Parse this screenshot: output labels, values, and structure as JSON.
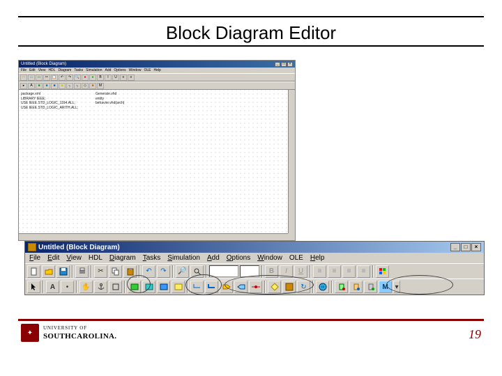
{
  "slide": {
    "title": "Block Diagram Editor",
    "page_number": "19",
    "university": {
      "prefix": "UNIVERSITY OF",
      "name": "SOUTHCAROLINA."
    }
  },
  "app_small": {
    "title": "Untitled (Block Diagram)",
    "menus": [
      "File",
      "Edit",
      "View",
      "HDL",
      "Diagram",
      "Tasks",
      "Simulation",
      "Add",
      "Options",
      "Window",
      "OLE",
      "Help"
    ],
    "panel_lines": [
      "package.xml",
      "LIBRARY IEEE;",
      "USE IEEE.STD_LOGIC_1164.ALL;",
      "USE IEEE.STD_LOGIC_ARITH.ALL;"
    ],
    "panel2_lines": [
      "Generate.vhd",
      "entity",
      "behavior.vhd(arch)"
    ]
  },
  "app_zoom": {
    "title": "Untitled (Block Diagram)",
    "menus": [
      {
        "u": "F",
        "rest": "ile"
      },
      {
        "u": "E",
        "rest": "dit"
      },
      {
        "u": "V",
        "rest": "iew"
      },
      {
        "u": "",
        "rest": "HDL"
      },
      {
        "u": "D",
        "rest": "iagram"
      },
      {
        "u": "T",
        "rest": "asks"
      },
      {
        "u": "S",
        "rest": "imulation"
      },
      {
        "u": "A",
        "rest": "dd"
      },
      {
        "u": "O",
        "rest": "ptions"
      },
      {
        "u": "W",
        "rest": "indow"
      },
      {
        "u": "",
        "rest": "OLE"
      },
      {
        "u": "H",
        "rest": "elp"
      }
    ],
    "win_buttons": [
      "_",
      "□",
      "×"
    ],
    "toolbar_row1": {
      "new": "",
      "open": "",
      "save": "",
      "print": "",
      "cut": "",
      "copy": "",
      "paste": "",
      "undo": "",
      "redo": "",
      "find": "",
      "zoom": "",
      "font_combo": "",
      "size_combo": "",
      "bold": "B",
      "italic": "I",
      "underline": "U",
      "align_l": "",
      "align_c": "",
      "align_r": "",
      "align_j": "",
      "color": ""
    },
    "toolbar_row2": {
      "cursor": "",
      "text": "A",
      "bullet": "•",
      "hand": "",
      "group1_a": "",
      "group1_b": "",
      "block_green": "",
      "block_teal": "",
      "block_blue": "",
      "block_yellow": "",
      "wire": "",
      "bus": "",
      "port_in": "",
      "port_out": "",
      "signal": "",
      "gnd": "",
      "diamond": "",
      "save2": "",
      "undo2": "",
      "globe": "",
      "mod1": "",
      "mod2": "",
      "mod3": "",
      "modM": "M"
    }
  }
}
